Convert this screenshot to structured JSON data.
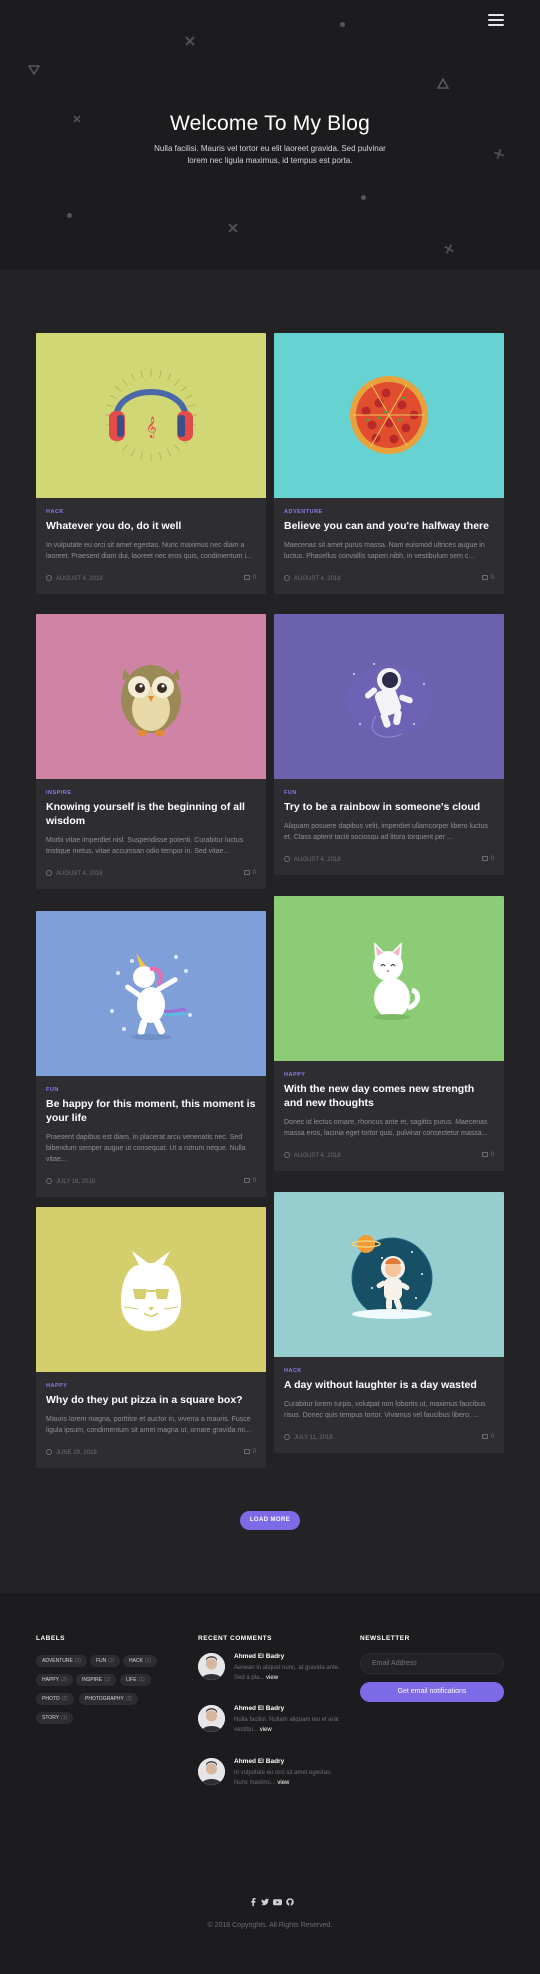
{
  "hero": {
    "title": "Welcome To My Blog",
    "subtitle": "Nulla facilisi. Mauris vel tortor eu elit laoreet gravida. Sed pulvinar lorem nec ligula maximus, id tempus est porta."
  },
  "menu_icon": "hamburger-menu-icon",
  "accent_color": "#7c6ae6",
  "posts": [
    {
      "tag": "HACK",
      "title": "Whatever you do, do it well",
      "excerpt": "In vulputate eu orci sit amet egestas. Nunc maximus nec diam a laoreet. Praesent diam dui, laoreet nec eros quis, condimentum i...",
      "date": "AUGUST 4, 2018",
      "comments": "0",
      "image_bg": "#d2d775",
      "image": "headphones"
    },
    {
      "tag": "ADVENTURE",
      "title": "Believe you can and you're halfway there",
      "excerpt": "Maecenas sit amet purus massa. Nam euismod ultrices augue in luctus. Phasellus convallis sapien nibh, in vestibulum sem c...",
      "date": "AUGUST 4, 2018",
      "comments": "0",
      "image_bg": "#66d3d2",
      "image": "pizza"
    },
    {
      "tag": "INSPIRE",
      "title": "Knowing yourself is the beginning of all wisdom",
      "excerpt": "Morbi vitae imperdiet nisl. Suspendisse potenti. Curabitur luctus tristique metus, vitae accumsan odio tempor in. Sed vitae...",
      "date": "AUGUST 4, 2018",
      "comments": "0",
      "image_bg": "#cf84a6",
      "image": "owl"
    },
    {
      "tag": "FUN",
      "title": "Try to be a rainbow in someone's cloud",
      "excerpt": "Aliquam posuere dapibus velit, imperdiet ullamcorper libero luctus et. Class aptent taciti sociosqu ad litora torquent per ...",
      "date": "AUGUST 4, 2018",
      "comments": "0",
      "image_bg": "#6b61ad",
      "image": "astronaut"
    },
    {
      "tag": "FUN",
      "title": "Be happy for this moment, this moment is your life",
      "excerpt": "Praesent dapibus est diam, in placerat arcu venenatis nec. Sed bibendum semper augue ut consequat. Ut a rutrum neque. Nulla vitae...",
      "date": "JULY 18, 2018",
      "comments": "0",
      "image_bg": "#7f9fd8",
      "image": "unicorn"
    },
    {
      "tag": "HAPPY",
      "title": "With the new day comes new strength and new thoughts",
      "excerpt": "Donec id lectus ornare, rhoncus ante et, sagittis purus. Maecenas massa eros, lacinia eget tortor quis, pulvinar consectetur massa...",
      "date": "AUGUST 4, 2018",
      "comments": "0",
      "image_bg": "#8ccc77",
      "image": "cat"
    },
    {
      "tag": "HAPPY",
      "title": "Why do they put pizza in a square box?",
      "excerpt": "Mauris lorem magna, porttitor et auctor in, viverra a mauris. Fusce ligula ipsum, condimentum sit amet magna ut, ornare gravida mi...",
      "date": "JUNE 29, 2018",
      "comments": "0",
      "image_bg": "#d4cf6c",
      "image": "cat-face"
    },
    {
      "tag": "HACK",
      "title": "A day without laughter is a day wasted",
      "excerpt": "Curabitur lorem turpis, volutpat non lobortis ut, maximus faucibus risus. Donec quis tempus tortor. Vivamus vel faucibus libero, ...",
      "date": "JULY 11, 2018",
      "comments": "0",
      "image_bg": "#96ced0",
      "image": "space-kid"
    }
  ],
  "load_more": "LOAD MORE",
  "footer": {
    "labels_heading": "LABELS",
    "labels": [
      {
        "name": "ADVENTURE",
        "count": "(1)"
      },
      {
        "name": "FUN",
        "count": "(2)"
      },
      {
        "name": "HACK",
        "count": "(2)"
      },
      {
        "name": "HAPPY",
        "count": "(2)"
      },
      {
        "name": "INSPIRE",
        "count": "(1)"
      },
      {
        "name": "LIFE",
        "count": "(1)"
      },
      {
        "name": "PHOTO",
        "count": "(2)"
      },
      {
        "name": "PHOTOGRAPHY",
        "count": "(3)"
      },
      {
        "name": "STORY",
        "count": "(1)"
      }
    ],
    "recent_heading": "RECENT COMMENTS",
    "recent_comments": [
      {
        "name": "Ahmed El Badry",
        "text": "Aenean in aliquet nunc, at gravida ante. Sed a pla...",
        "view": "view"
      },
      {
        "name": "Ahmed El Badry",
        "text": "Nulla facilisi. Nullam aliquam leo et erat vestibu...",
        "view": "view"
      },
      {
        "name": "Ahmed El Badry",
        "text": "In vulputate eu orci sit amet egestas. Nunc maximu...",
        "view": "view"
      }
    ],
    "newsletter_heading": "NEWSLETTER",
    "email_placeholder": "Email Address",
    "subscribe_label": "Get email notifications",
    "social": [
      "f",
      "t",
      "yt",
      "gh"
    ],
    "copyright": "© 2018 Copyrights. All Rights Reserved."
  }
}
